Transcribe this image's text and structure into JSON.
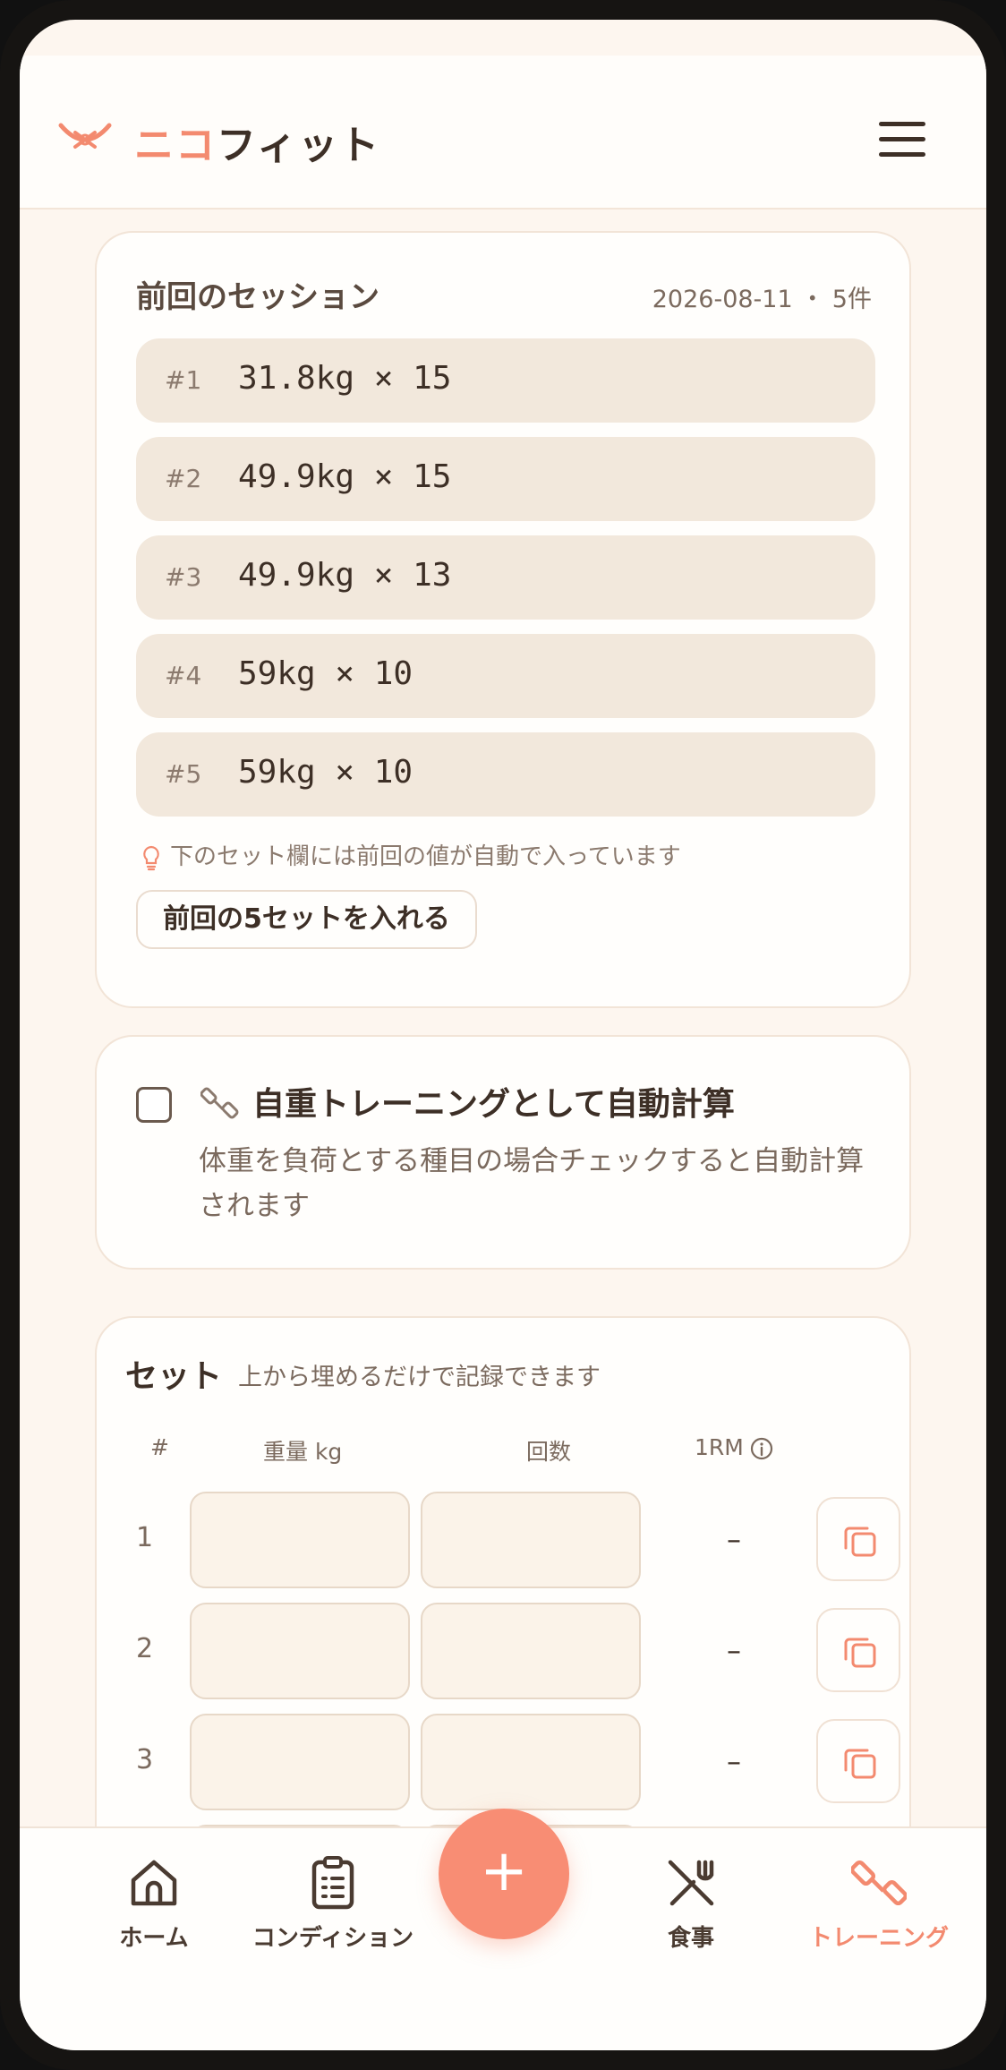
{
  "app": {
    "logo_part1": "ニコ",
    "logo_part2": "フィット",
    "accent_color": "#f38a6f"
  },
  "previous_session": {
    "title": "前回のセッション",
    "meta": "2026-08-11 ・ 5件",
    "sets": [
      {
        "num": "#1",
        "value": "31.8kg × 15"
      },
      {
        "num": "#2",
        "value": "49.9kg × 15"
      },
      {
        "num": "#3",
        "value": "49.9kg × 13"
      },
      {
        "num": "#4",
        "value": "59kg × 10"
      },
      {
        "num": "#5",
        "value": "59kg × 10"
      }
    ],
    "hint": "下のセット欄には前回の値が自動で入っています",
    "copy_button": "前回の5セットを入れる"
  },
  "bodyweight": {
    "title": "自重トレーニングとして自動計算",
    "description": "体重を負荷とする種目の場合チェックすると自動計算されます",
    "checked": false
  },
  "sets": {
    "title": "セット",
    "subtitle": "上から埋めるだけで記録できます",
    "headers": {
      "num": "#",
      "weight": "重量 kg",
      "reps": "回数",
      "one_rm": "1RM"
    },
    "rows": [
      {
        "num": "1",
        "weight": "",
        "reps": "",
        "one_rm": "–"
      },
      {
        "num": "2",
        "weight": "",
        "reps": "",
        "one_rm": "–"
      },
      {
        "num": "3",
        "weight": "",
        "reps": "",
        "one_rm": "–"
      }
    ]
  },
  "nav": {
    "items": [
      {
        "label": "ホーム",
        "icon": "home-icon"
      },
      {
        "label": "コンディション",
        "icon": "clipboard-icon"
      },
      {
        "label": "食事",
        "icon": "utensils-icon"
      },
      {
        "label": "トレーニング",
        "icon": "dumbbell-icon",
        "active": true
      }
    ],
    "fab": "+"
  }
}
